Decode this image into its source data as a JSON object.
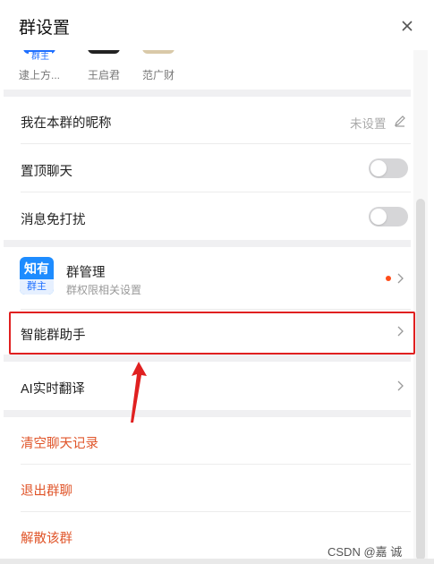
{
  "header": {
    "title": "群设置",
    "close_icon": "close-icon"
  },
  "members": [
    {
      "name": "逮上方...",
      "badge": "群主",
      "avatar_color": "#1e6fff"
    },
    {
      "name": "王启君",
      "avatar_color": "#222222"
    },
    {
      "name": "范广财",
      "avatar_color": "#d9c9a8"
    }
  ],
  "settings": {
    "nickname": {
      "label": "我在本群的昵称",
      "value": "未设置"
    },
    "pin_chat": {
      "label": "置顶聊天",
      "enabled": false
    },
    "mute": {
      "label": "消息免打扰",
      "enabled": false
    }
  },
  "group_manage": {
    "icon_top": "知有",
    "icon_bottom": "群主",
    "title": "群管理",
    "subtitle": "群权限相关设置",
    "dot_color": "#ff4d1a"
  },
  "smart_assistant": {
    "label": "智能群助手"
  },
  "ai_translate": {
    "label": "AI实时翻译"
  },
  "actions": {
    "clear_history": "清空聊天记录",
    "quit_group": "退出群聊",
    "dissolve_group": "解散该群"
  },
  "annotation": {
    "highlight_color": "#e02020"
  },
  "watermark": "CSDN @嘉    诚",
  "colors": {
    "danger": "#e0562b",
    "accent": "#1e8cff"
  }
}
